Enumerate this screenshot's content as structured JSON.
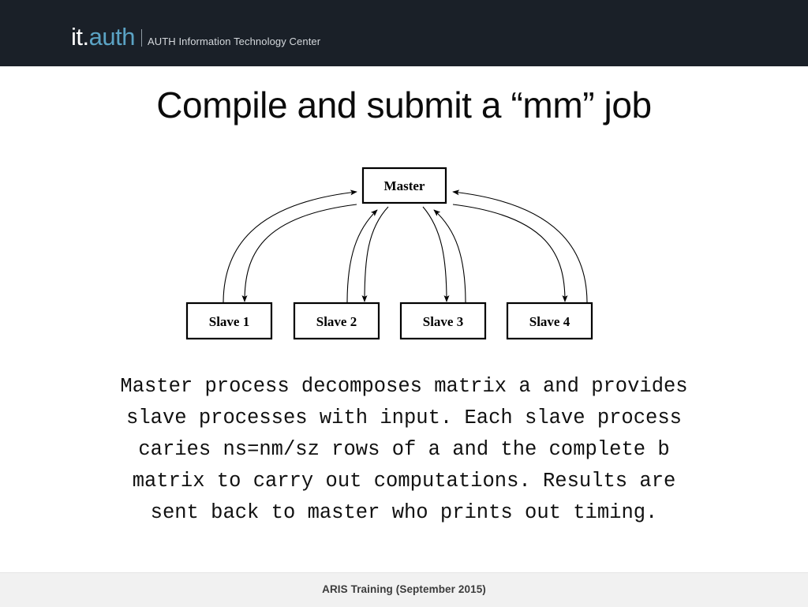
{
  "header": {
    "brand_primary": "it.",
    "brand_accent": "auth",
    "divider": "|",
    "subtitle": "AUTH Information Technology Center",
    "bg_color": "#1a2028",
    "accent_color": "#5ba3c4"
  },
  "slide": {
    "title": "Compile and submit a “mm” job"
  },
  "diagram": {
    "type": "master-slave-topology",
    "master": {
      "label": "Master"
    },
    "slaves": [
      {
        "label": "Slave 1"
      },
      {
        "label": "Slave 2"
      },
      {
        "label": "Slave 3"
      },
      {
        "label": "Slave 4"
      }
    ],
    "edge_description": "bidirectional curved arrows between master and each slave",
    "stroke_color": "#000000",
    "fill_color": "#ffffff"
  },
  "body": {
    "lines": [
      "Master process decomposes matrix a and provides",
      "slave processes with input. Each slave process",
      "caries ns=nm/sz rows of a and the complete b",
      "matrix to carry out computations. Results are",
      "sent back to master who prints out timing."
    ]
  },
  "footer": {
    "text": "ARIS Training (September 2015)",
    "bg_color": "#f1f1f1"
  }
}
